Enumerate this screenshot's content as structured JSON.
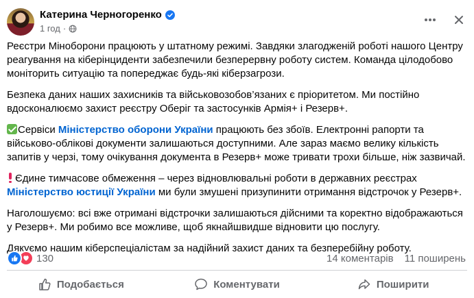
{
  "post": {
    "author": "Катерина Черногоренко",
    "timestamp": "1 год",
    "audience_icon": "globe-icon",
    "verified_icon": "verified-badge-icon",
    "paragraphs": {
      "p1": "Реєстри Міноборони працюють у штатному режимі. Завдяки злагодженій роботі нашого Центру реагування на кіберінциденти забезпечили безперервну роботу систем. Команда цілодобово моніторить ситуацію та попереджає будь-які кіберзагрози.",
      "p2": "Безпека даних наших захисників та військовозобов’язаних є пріоритетом. Ми постійно вдосконалюємо захист реєстру Оберіг та застосунків Армія+ і Резерв+.",
      "p3_pre": "Сервіси ",
      "p3_link": "Міністерство оборони України",
      "p3_post": " працюють без збоїв. Електронні рапорти та військово-облікові документи залишаються доступними. Але зараз маємо велику кількість запитів у черзі, тому очікування документа в Резерв+ може тривати трохи більше, ніж зазвичай.",
      "p4_pre": "Єдине тимчасове обмеження – через відновлювальні роботи в державних реєстрах ",
      "p4_link": "Міністерство юстиції України",
      "p4_post": " ми були змушені призупинити отримання відстрочок у Резерв+.",
      "p5": "Наголошуємо: всі вже отримані відстрочки залишаються дійсними та коректно відображаються у Резерв+. Ми робимо все можливе, щоб якнайшвидше відновити цю послугу.",
      "p6": "Дякуємо нашим кіберспеціалістам за надійний захист даних та безперебійну роботу."
    },
    "stats": {
      "reactions_count": "130",
      "comments": "14 коментарів",
      "shares": "11 поширень"
    },
    "actions": {
      "like": "Подобається",
      "comment": "Коментувати",
      "share": "Поширити"
    }
  },
  "colors": {
    "link": "#0064d1",
    "muted": "#65676b",
    "like_blue": "#1877f2",
    "love_red": "#f33e58",
    "check_green": "#63b64c"
  }
}
